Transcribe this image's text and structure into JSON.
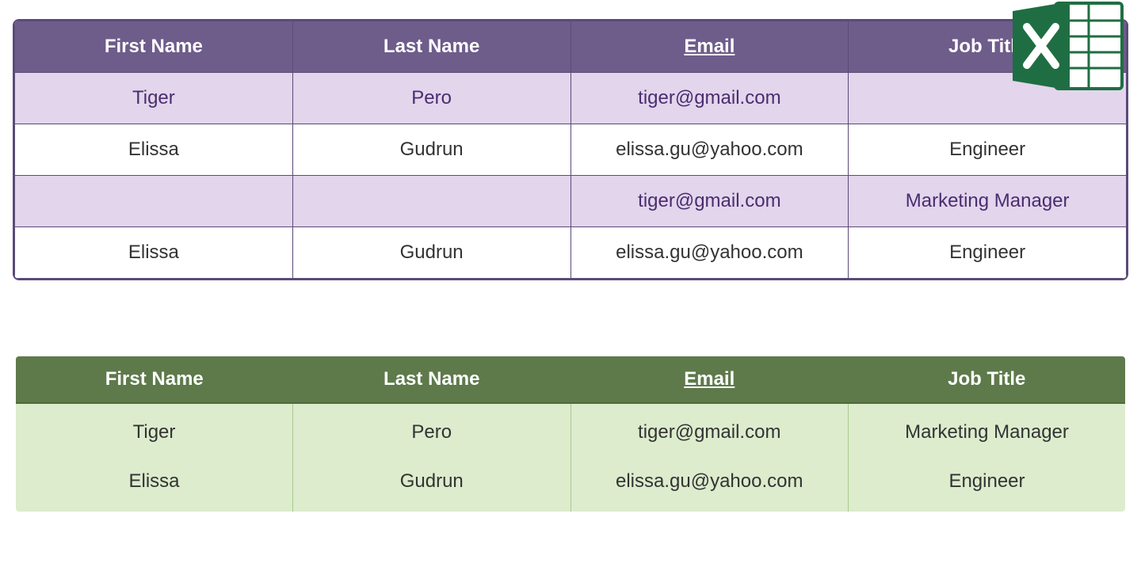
{
  "purple_table": {
    "headers": {
      "first_name": "First Name",
      "last_name": "Last Name",
      "email": "Email",
      "job_title": "Job Title"
    },
    "rows": [
      {
        "first_name": "Tiger",
        "last_name": "Pero",
        "email": "tiger@gmail.com",
        "job_title": ""
      },
      {
        "first_name": "Elissa",
        "last_name": "Gudrun",
        "email": "elissa.gu@yahoo.com",
        "job_title": "Engineer"
      },
      {
        "first_name": "",
        "last_name": "",
        "email": "tiger@gmail.com",
        "job_title": "Marketing Manager"
      },
      {
        "first_name": "Elissa",
        "last_name": "Gudrun",
        "email": "elissa.gu@yahoo.com",
        "job_title": "Engineer"
      }
    ]
  },
  "green_table": {
    "headers": {
      "first_name": "First Name",
      "last_name": "Last Name",
      "email": "Email",
      "job_title": "Job Title"
    },
    "rows": [
      {
        "first_name": "Tiger",
        "last_name": "Pero",
        "email": "tiger@gmail.com",
        "job_title": "Marketing Manager"
      },
      {
        "first_name": "Elissa",
        "last_name": "Gudrun",
        "email": "elissa.gu@yahoo.com",
        "job_title": "Engineer"
      }
    ]
  }
}
